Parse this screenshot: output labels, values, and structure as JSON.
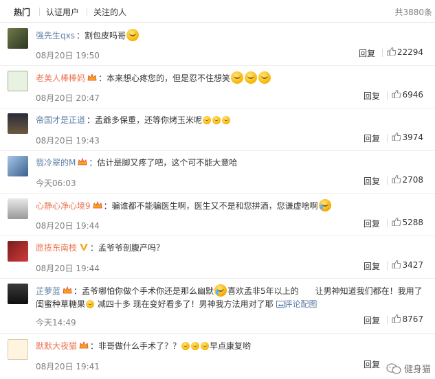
{
  "tabs": {
    "items": [
      {
        "label": "热门"
      },
      {
        "label": "认证用户"
      },
      {
        "label": "关注的人"
      }
    ],
    "total": "共3880条"
  },
  "comments": [
    {
      "user": "强先生qxs",
      "text": "割包皮吗哥",
      "time": "08月20日 19:50",
      "reply": "回复",
      "likes": "22294"
    },
    {
      "user": "老美人棒棒妈",
      "text": "本来想心疼您的，但是忍不住想笑",
      "time": "08月20日 20:47",
      "reply": "回复",
      "likes": "6946"
    },
    {
      "user": "帝国才是正道",
      "text": "孟爺多保重，还等你烤玉米呢",
      "time": "08月20日 19:43",
      "reply": "回复",
      "likes": "3974"
    },
    {
      "user": "翡冷翠的M",
      "text": "估计是脚又疼了吧，这个可不能大意哈",
      "time": "今天06:03",
      "reply": "回复",
      "likes": "2708"
    },
    {
      "user": "心静心净心境9",
      "text": "骗谁都不能骗医生啊，医生又不是和您拼酒，您谦虚啥啊",
      "time": "08月20日 19:44",
      "reply": "回复",
      "likes": "5288"
    },
    {
      "user": "愿揽东南枝",
      "text": "孟爷爷剖腹产吗？",
      "time": "08月20日 19:44",
      "reply": "回复",
      "likes": "3427"
    },
    {
      "user": "芷萝蓝",
      "text_a": "孟爷哪怕你做个手术你还是那么幽默",
      "text_b": "喜欢孟非5年以上的　　让男神知道我们都在！我用了",
      "text_c": "闺蜜种草糖果",
      "text_d": "减四十多 现在变好看多了！男神我方法用对了耶",
      "link": "评论配图",
      "time": "今天14:49",
      "reply": "回复",
      "likes": "8767"
    },
    {
      "user": "默默大夜猫",
      "text": "非哥做什么手术了？？",
      "text_b": "早点康复哟",
      "time": "08月20日 19:41",
      "reply": "回复"
    }
  ],
  "watermark": "健身猫",
  "colors": {
    "username": "#eb7350",
    "link": "#5d7da6",
    "meta": "#808080"
  }
}
